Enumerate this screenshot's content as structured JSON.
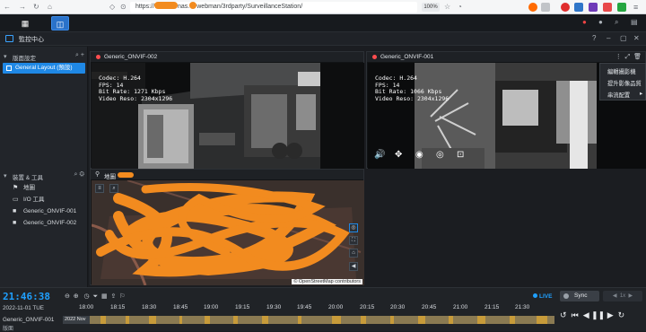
{
  "browser": {
    "url": "https://nas.webman/3rdparty/SurveillanceStation/",
    "url_prefix": "https://",
    "url_mid": "nas.",
    "url_suffix": "webman/3rdparty/SurveillanceStation/",
    "zoom": "100%"
  },
  "app": {
    "title": "監控中心"
  },
  "sidebar": {
    "layout_section": "版面設定",
    "layout_item": "General Layout (預設)",
    "devices_section": "裝置 & 工具",
    "devices": [
      {
        "label": "地圖",
        "icon": "map-icon"
      },
      {
        "label": "I/O 工具",
        "icon": "io-icon"
      },
      {
        "label": "Generic_ONVIF-001",
        "icon": "camera-icon"
      },
      {
        "label": "Generic_ONVIF-002",
        "icon": "camera-icon"
      }
    ]
  },
  "panels": {
    "cam1": {
      "name": "Generic_ONVIF-002",
      "overlay": "Codec: H.264\nFPS: 14\nBit Rate: 1271 Kbps\nVideo Reso: 2304x1296"
    },
    "cam2": {
      "name": "Generic_ONVIF-001",
      "overlay": "Codec: H.264\nFPS: 14\nBit Rate: 1066 Kbps\nVideo Reso: 2304x1296"
    },
    "map": {
      "name": "地圖",
      "attribution": "© OpenStreetMap contributors"
    }
  },
  "context_menu": {
    "items": [
      "編輯攝影機",
      "提升影像品質",
      "串流配置"
    ]
  },
  "timeline": {
    "clock": "21:46:38",
    "date": "2022-11-01 TUE",
    "camera": "Generic_ONVIF-001",
    "sub_label": "版面",
    "hours": [
      "18:00",
      "18:15",
      "18:30",
      "18:45",
      "19:00",
      "19:15",
      "19:30",
      "19:45",
      "20:00",
      "20:15",
      "20:30",
      "20:45",
      "21:00",
      "21:15",
      "21:30"
    ],
    "track_label": "2022 Nov",
    "live": "LIVE",
    "sync": "Sync",
    "speed": "1x"
  },
  "colors": {
    "accent": "#1f88e5",
    "live": "#1fa0ff",
    "recording": "#c79b3a",
    "redact": "#f28b1f"
  }
}
